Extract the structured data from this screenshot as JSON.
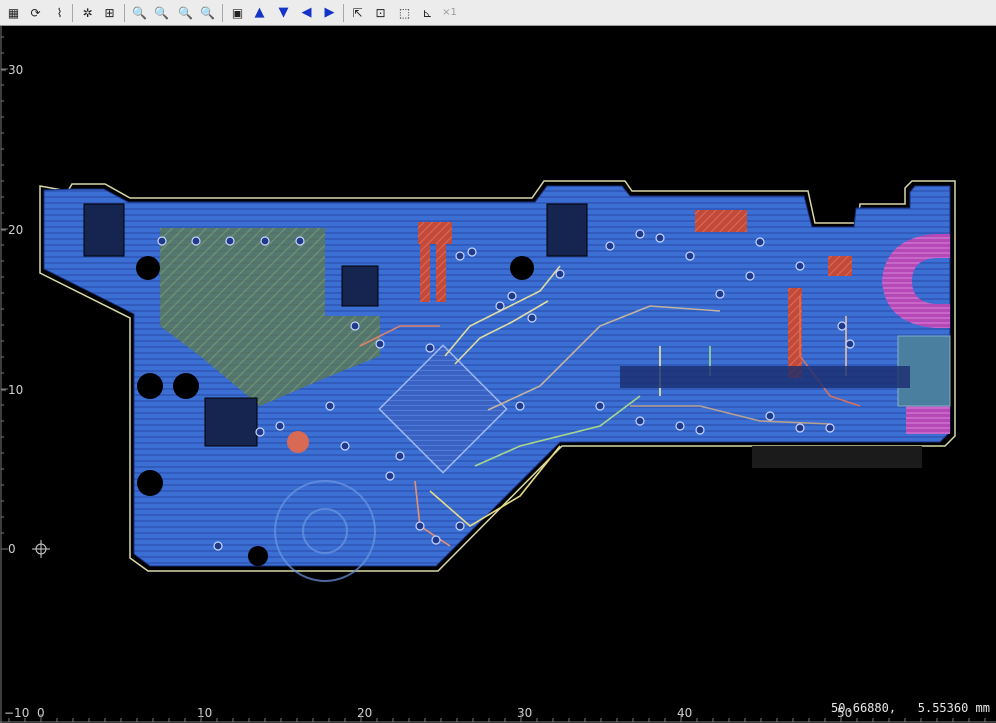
{
  "toolbar": {
    "buttons": [
      {
        "name": "layers-table-button",
        "icon": "table-icon",
        "glyph": "▦"
      },
      {
        "name": "redraw-button",
        "icon": "refresh-icon",
        "glyph": "⟳"
      },
      {
        "name": "route-button",
        "icon": "route-icon",
        "glyph": "⌇"
      },
      {
        "name": "settings-button",
        "icon": "gear-icon",
        "glyph": "✲"
      },
      {
        "name": "fit-all-button",
        "icon": "zoom-fit-icon",
        "glyph": "⊞"
      },
      {
        "name": "zoom-in-button",
        "icon": "zoom-in-icon",
        "glyph": "🔍"
      },
      {
        "name": "zoom-area-button",
        "icon": "zoom-area-icon",
        "glyph": "🔍"
      },
      {
        "name": "zoom-out-button",
        "icon": "zoom-out-icon",
        "glyph": "🔍"
      },
      {
        "name": "zoom-previous-button",
        "icon": "zoom-previous-icon",
        "glyph": "🔍"
      },
      {
        "name": "page-button",
        "icon": "page-icon",
        "glyph": "▣"
      },
      {
        "name": "pan-up-button",
        "icon": "arrow-up-icon",
        "glyph": "▲"
      },
      {
        "name": "pan-down-button",
        "icon": "arrow-down-icon",
        "glyph": "▼"
      },
      {
        "name": "pan-left-button",
        "icon": "arrow-left-icon",
        "glyph": "◀"
      },
      {
        "name": "pan-right-button",
        "icon": "arrow-right-icon",
        "glyph": "▶"
      },
      {
        "name": "select-button",
        "icon": "cursor-icon",
        "glyph": "⇱"
      },
      {
        "name": "select-box-button",
        "icon": "select-box-icon",
        "glyph": "⊡"
      },
      {
        "name": "select-area-button",
        "icon": "dotted-box-icon",
        "glyph": "⬚"
      },
      {
        "name": "measure-button",
        "icon": "measure-icon",
        "glyph": "⊾"
      },
      {
        "name": "multiplier-button",
        "icon": "multiply-icon",
        "glyph": "×1",
        "disabled": true
      }
    ]
  },
  "ruler": {
    "y_labels": [
      "30",
      "20",
      "10",
      "0"
    ],
    "x_labels": [
      "−10",
      "0",
      "10",
      "20",
      "30",
      "40",
      "50"
    ]
  },
  "status": {
    "coordinates": "50.66880,   5.55360 mm"
  },
  "colors": {
    "background": "#000000",
    "copper_pour": "#3f74d8",
    "copper_hatch": "#23398f",
    "outline": "#d8d8a8",
    "ruler_text": "#cfcfcf"
  }
}
